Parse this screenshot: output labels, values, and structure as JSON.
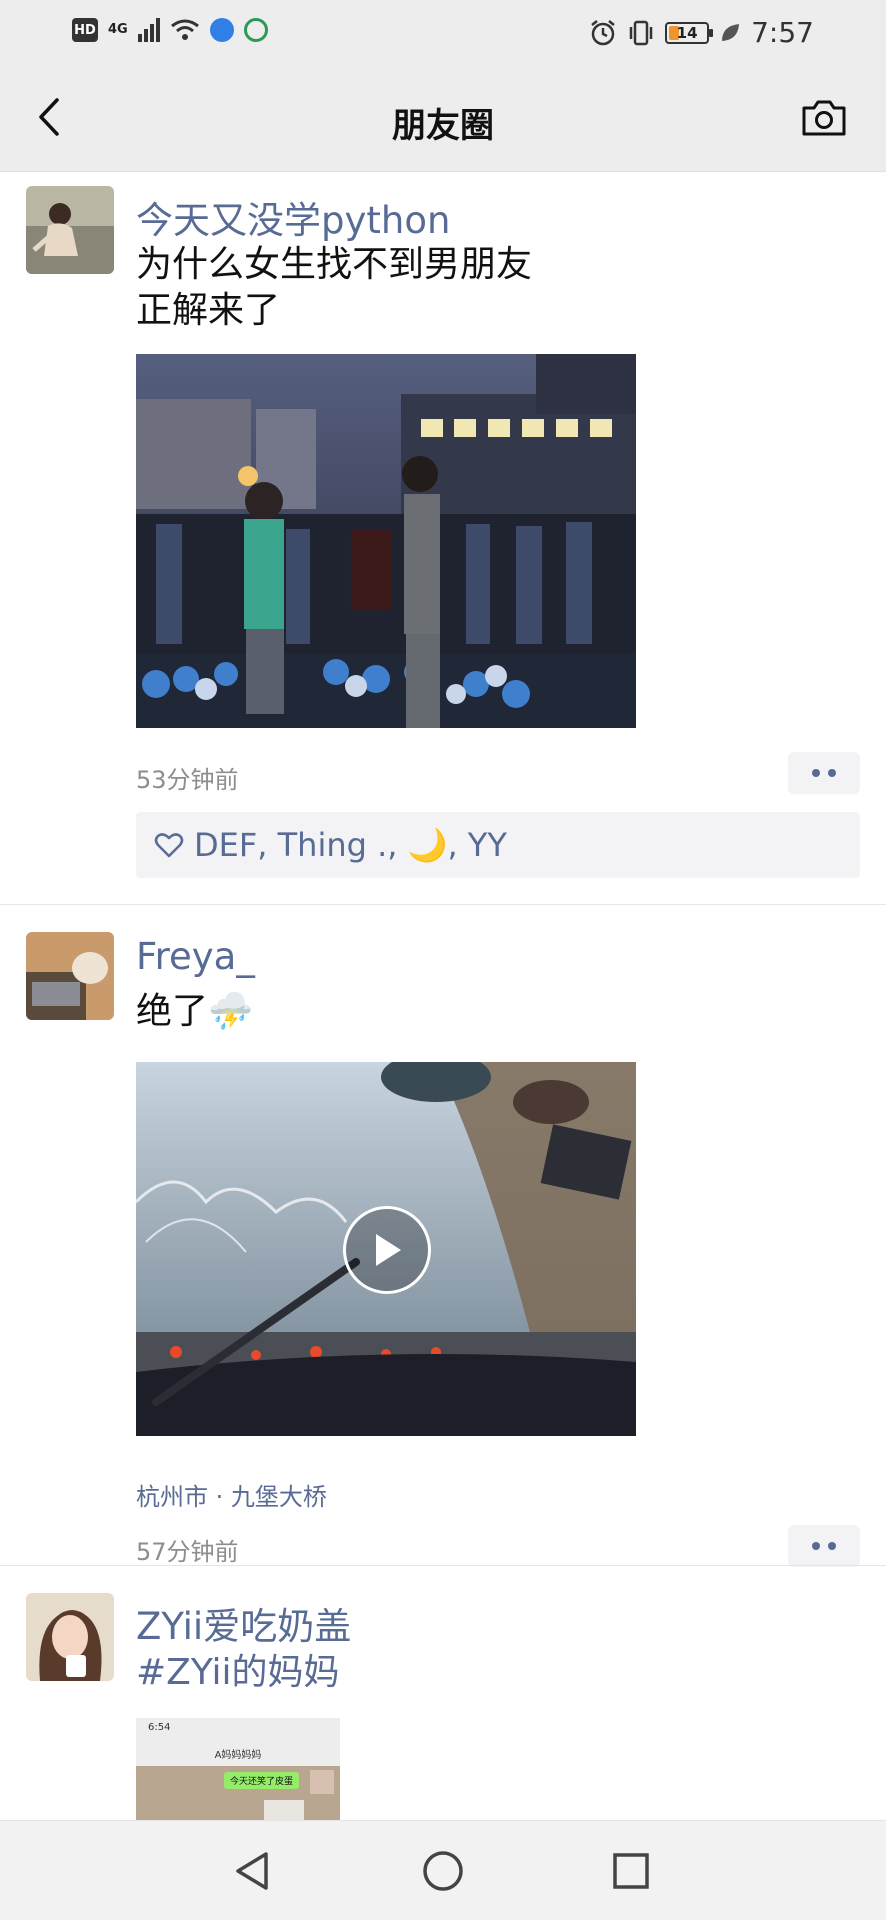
{
  "status_bar": {
    "hd": "HD",
    "network": "4G",
    "battery": "14",
    "time": "7:57"
  },
  "nav": {
    "title": "朋友圈"
  },
  "posts": [
    {
      "author": "今天又没学python",
      "text": "为什么女生找不到男朋友\n正解来了",
      "time": "53分钟前",
      "likes": "DEF, Thing ., 🌙, YY"
    },
    {
      "author": "Freya_",
      "text": "绝了⛈️",
      "location": "杭州市 · 九堡大桥",
      "time": "57分钟前"
    },
    {
      "author": "ZYii爱吃奶盖",
      "text": "#ZYii的妈妈",
      "thumb": {
        "time": "6:54",
        "title": "A妈妈妈妈",
        "bubble": "今天还笑了皮蛋"
      }
    }
  ],
  "colors": {
    "link": "#576b95",
    "bar_bg": "#ededed",
    "like_bg": "#f3f3f5"
  }
}
